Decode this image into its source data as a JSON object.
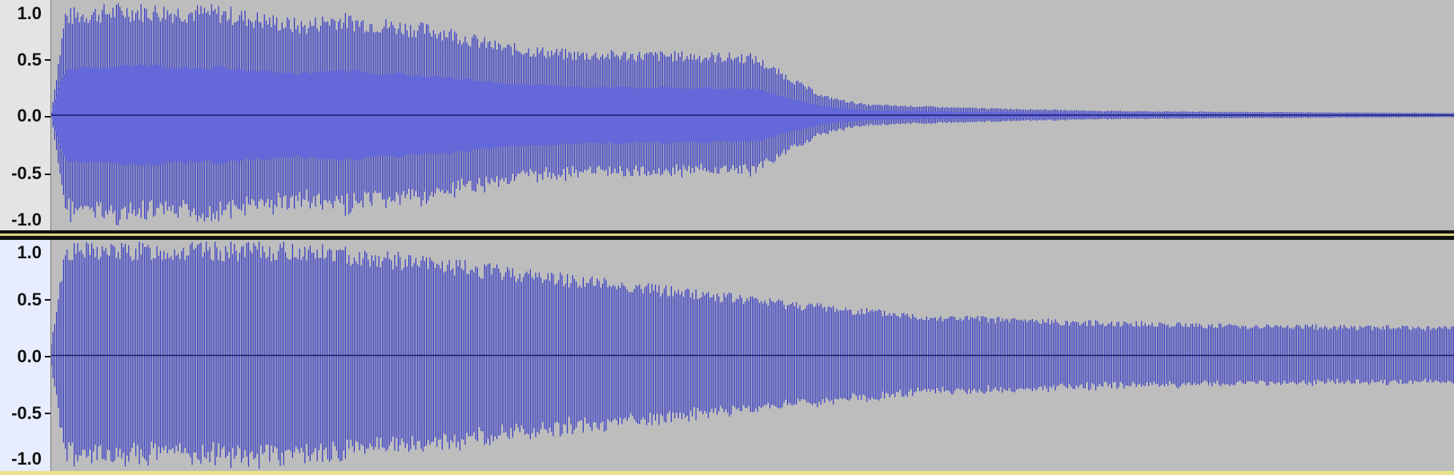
{
  "tracks": [
    {
      "id": "track-1",
      "axis_labels": [
        "1.0",
        "0.5",
        "0.0",
        "-0.5",
        "-1.0"
      ],
      "axis_values": [
        1.0,
        0.5,
        0.0,
        -0.5,
        -1.0
      ],
      "envelope": [
        [
          0.0,
          0.02
        ],
        [
          0.01,
          0.95
        ],
        [
          0.05,
          1.0
        ],
        [
          0.12,
          0.98
        ],
        [
          0.18,
          0.85
        ],
        [
          0.2,
          0.92
        ],
        [
          0.24,
          0.86
        ],
        [
          0.28,
          0.8
        ],
        [
          0.32,
          0.65
        ],
        [
          0.37,
          0.58
        ],
        [
          0.44,
          0.57
        ],
        [
          0.5,
          0.55
        ],
        [
          0.52,
          0.4
        ],
        [
          0.55,
          0.18
        ],
        [
          0.58,
          0.1
        ],
        [
          0.65,
          0.07
        ],
        [
          0.75,
          0.04
        ],
        [
          0.85,
          0.03
        ],
        [
          1.0,
          0.02
        ]
      ],
      "core_ratio": 0.45
    },
    {
      "id": "track-2",
      "axis_labels": [
        "1.0",
        "0.5",
        "0.0",
        "-0.5",
        "-1.0"
      ],
      "axis_values": [
        1.0,
        0.5,
        0.0,
        -0.5,
        -1.0
      ],
      "envelope": [
        [
          0.0,
          0.1
        ],
        [
          0.01,
          1.0
        ],
        [
          0.18,
          1.0
        ],
        [
          0.22,
          0.95
        ],
        [
          0.32,
          0.8
        ],
        [
          0.42,
          0.65
        ],
        [
          0.52,
          0.5
        ],
        [
          0.62,
          0.37
        ],
        [
          0.72,
          0.32
        ],
        [
          0.85,
          0.28
        ],
        [
          1.0,
          0.26
        ]
      ],
      "core_ratio": 0.0
    }
  ],
  "colors": {
    "wave_fill": "#6468d8",
    "wave_line": "#3338c6",
    "background": "#bdbdbd",
    "zero_line": "#1b1d6a"
  }
}
